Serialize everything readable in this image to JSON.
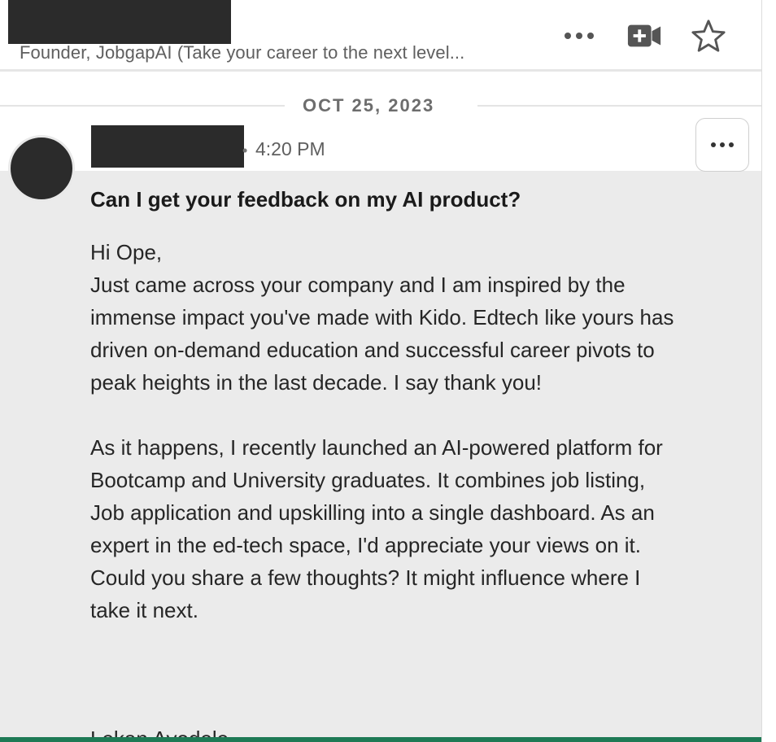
{
  "header": {
    "headline": "Founder, JobgapAI (Take your career to the next level..."
  },
  "date_divider": {
    "label": "OCT 25, 2023"
  },
  "message": {
    "bullet": "•",
    "time": "4:20 PM",
    "subject": "Can I get your feedback on my AI product?",
    "greeting": "Hi Ope,",
    "paragraph1": "Just came across your company and I am inspired by the immense impact you've made with Kido. Edtech like yours has driven on-demand education and successful career pivots to peak heights in the last decade. I say thank you!",
    "paragraph2": "As it happens, I recently launched an AI-powered platform for Bootcamp and University graduates. It combines job listing, Job application and upskilling into a single dashboard. As an expert in the ed-tech space, I'd appreciate your views on it. Could you share a few thoughts? It might influence where I take it next.",
    "signoff": "Lekan Ayodele"
  },
  "icons": {
    "more": "more-horizontal-icon",
    "video": "video-call-icon",
    "star": "star-outline-icon",
    "message_more": "more-horizontal-icon"
  },
  "colors": {
    "redaction": "#2b2b2b",
    "message_bg": "#ebebeb",
    "accent_bar": "#1e7a55",
    "icon": "#555555"
  }
}
